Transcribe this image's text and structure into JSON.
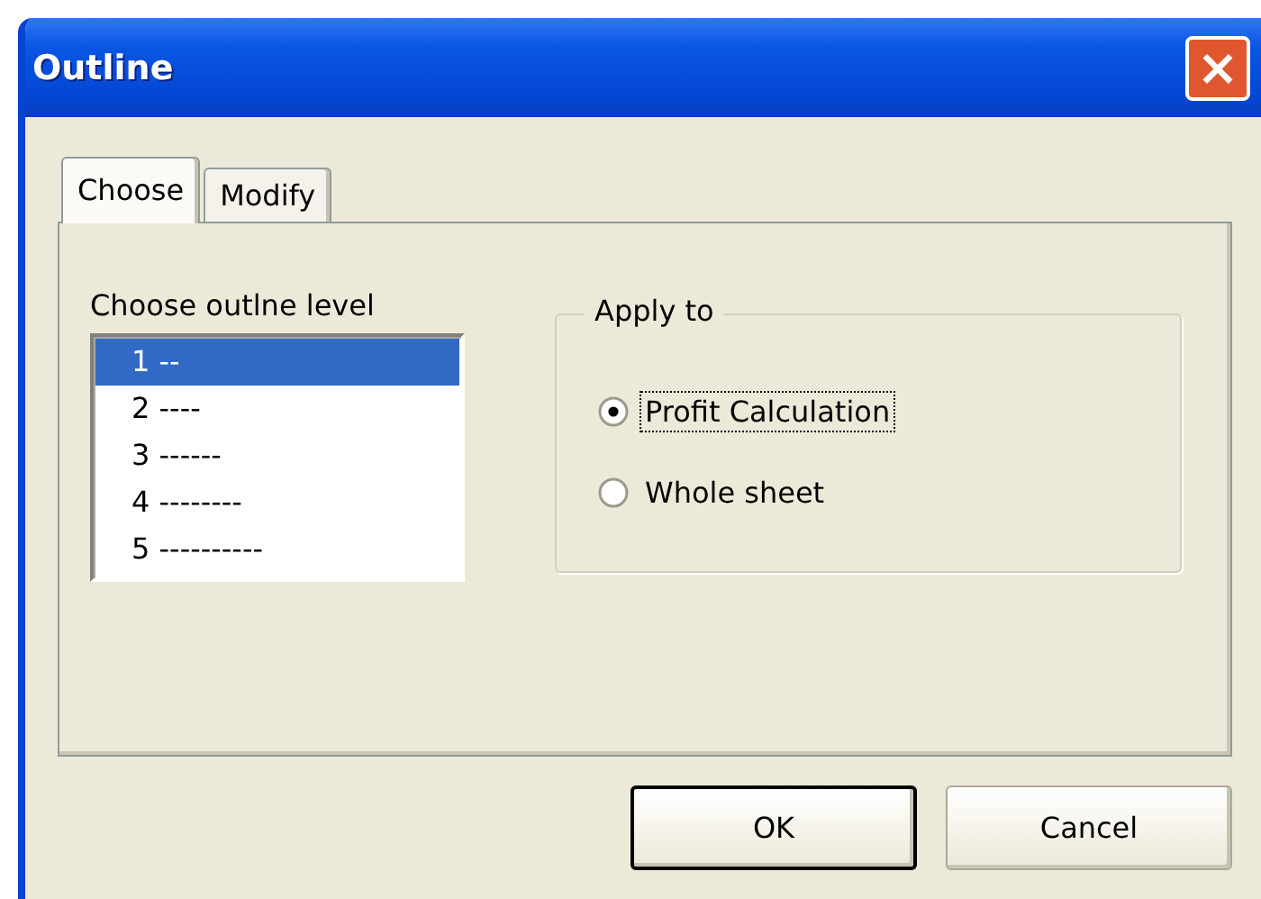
{
  "window": {
    "title": "Outline",
    "close_label": "×"
  },
  "tabs": [
    {
      "label": "Choose",
      "selected": true
    },
    {
      "label": "Modify",
      "selected": false
    }
  ],
  "level_list": {
    "label": "Choose outlne level",
    "items": [
      {
        "text": "1 --",
        "selected": true
      },
      {
        "text": "2 ----",
        "selected": false
      },
      {
        "text": "3 ------",
        "selected": false
      },
      {
        "text": "4 --------",
        "selected": false
      },
      {
        "text": "5 ----------",
        "selected": false
      }
    ]
  },
  "apply_to": {
    "title": "Apply to",
    "options": [
      {
        "label": "Profit Calculation",
        "selected": true
      },
      {
        "label": "Whole sheet",
        "selected": false
      }
    ]
  },
  "buttons": [
    {
      "label": "OK",
      "default": true
    },
    {
      "label": "Cancel",
      "default": false
    }
  ]
}
